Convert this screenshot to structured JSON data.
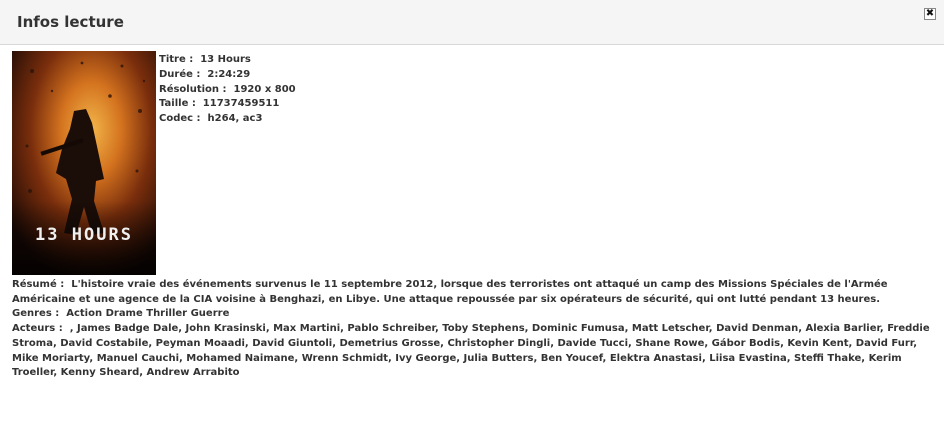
{
  "dialog": {
    "title": "Infos lecture",
    "close_symbol": "✖"
  },
  "poster": {
    "title_text": "13 HOURS"
  },
  "specs": [
    {
      "label": "Titre :",
      "value": "13 Hours"
    },
    {
      "label": "Durée :",
      "value": "2:24:29"
    },
    {
      "label": "Résolution :",
      "value": "1920 x 800"
    },
    {
      "label": "Taille :",
      "value": "11737459511"
    },
    {
      "label": "Codec :",
      "value": "h264, ac3"
    }
  ],
  "details": {
    "resume_label": "Résumé :",
    "resume": "L'histoire vraie des événements survenus le 11 septembre 2012, lorsque des terroristes ont attaqué un camp des Missions Spéciales de l'Armée Américaine et une agence de la CIA voisine à Benghazi, en Libye. Une attaque repoussée par six opérateurs de sécurité, qui ont lutté pendant 13 heures.",
    "genres_label": "Genres :",
    "genres": "Action Drame Thriller Guerre",
    "acteurs_label": "Acteurs :",
    "acteurs": ", James Badge Dale, John Krasinski, Max Martini, Pablo Schreiber, Toby Stephens, Dominic Fumusa, Matt Letscher, David Denman, Alexia Barlier, Freddie Stroma, David Costabile, Peyman Moaadi, David Giuntoli, Demetrius Grosse, Christopher Dingli, Davide Tucci, Shane Rowe, Gábor Bodis, Kevin Kent, David Furr, Mike Moriarty, Manuel Cauchi, Mohamed Naimane, Wrenn Schmidt, Ivy George, Julia Butters, Ben Youcef, Elektra Anastasi, Liisa Evastina, Steffi Thake, Kerim Troeller, Kenny Sheard, Andrew Arrabito"
  }
}
